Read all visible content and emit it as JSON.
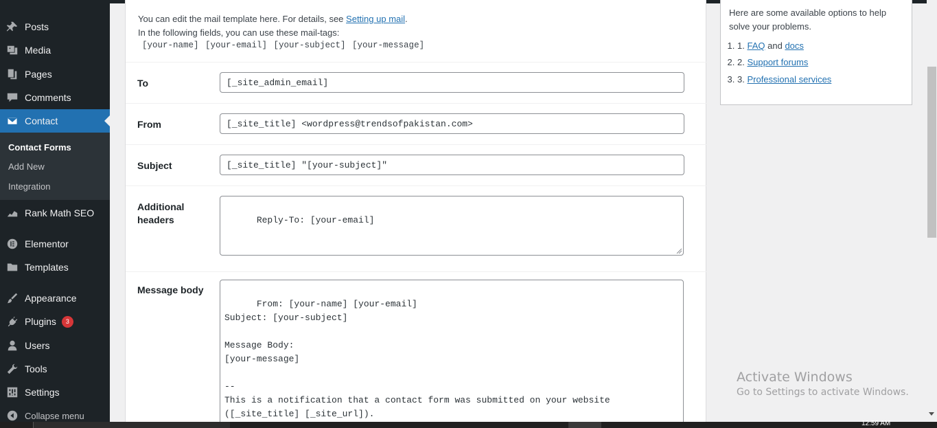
{
  "sidebar": {
    "items": [
      {
        "label": "Posts",
        "icon": "pushpin-icon"
      },
      {
        "label": "Media",
        "icon": "media-icon"
      },
      {
        "label": "Pages",
        "icon": "pages-icon"
      },
      {
        "label": "Comments",
        "icon": "comment-icon"
      },
      {
        "label": "Contact",
        "icon": "envelope-icon"
      },
      {
        "label": "Rank Math SEO",
        "icon": "chart-icon"
      },
      {
        "label": "Elementor",
        "icon": "elementor-icon"
      },
      {
        "label": "Templates",
        "icon": "folder-icon"
      },
      {
        "label": "Appearance",
        "icon": "paintbrush-icon"
      },
      {
        "label": "Plugins",
        "icon": "plug-icon",
        "badge": "3"
      },
      {
        "label": "Users",
        "icon": "user-icon"
      },
      {
        "label": "Tools",
        "icon": "wrench-icon"
      },
      {
        "label": "Settings",
        "icon": "settings-icon"
      }
    ],
    "submenu": [
      "Contact Forms",
      "Add New",
      "Integration"
    ],
    "collapse_label": "Collapse menu"
  },
  "main": {
    "intro_text": "You can edit the mail template here. For details, see",
    "intro_link": "Setting up mail",
    "intro_period": ".",
    "intro_tags_text": "In the following fields, you can use these mail-tags:",
    "tags": "[your-name] [your-email] [your-subject] [your-message]",
    "fields": {
      "to": {
        "label": "To",
        "value": "[_site_admin_email]"
      },
      "from": {
        "label": "From",
        "value": "[_site_title] <wordpress@trendsofpakistan.com>"
      },
      "subject": {
        "label": "Subject",
        "value": "[_site_title] \"[your-subject]\""
      },
      "headers": {
        "label_line1": "Additional",
        "label_line2": "headers",
        "value": "Reply-To: [your-email]"
      },
      "body": {
        "label": "Message body",
        "value": "From: [your-name] [your-email]\nSubject: [your-subject]\n\nMessage Body:\n[your-message]\n\n--\nThis is a notification that a contact form was submitted on your website\n([_site_title] [_site_url])."
      }
    }
  },
  "help": {
    "text": "Here are some available options to help solve your problems.",
    "faq": "FAQ",
    "and": "and",
    "docs": "docs",
    "support": "Support forums",
    "professional": "Professional services"
  },
  "watermark": {
    "title": "Activate Windows",
    "subtitle": "Go to Settings to activate Windows."
  },
  "taskbar": {
    "time": "12:59 AM"
  },
  "colors": {
    "sidebar": "#1d2327",
    "accent": "#2271b1",
    "badge": "#d63638"
  }
}
